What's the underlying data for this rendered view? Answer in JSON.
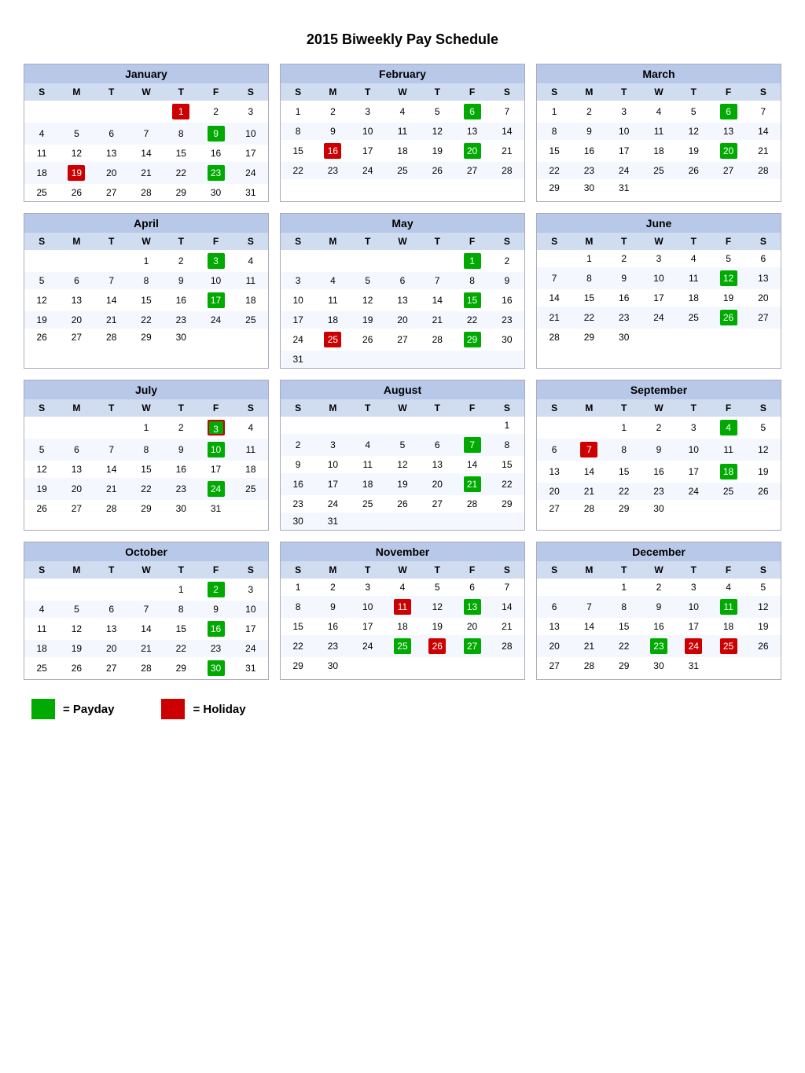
{
  "title": "2015 Biweekly Pay Schedule",
  "months": [
    {
      "name": "January",
      "weeks": [
        [
          "",
          "",
          "",
          "",
          "1H",
          "2",
          "3"
        ],
        [
          "4",
          "5",
          "6",
          "7",
          "8",
          "9P",
          "10"
        ],
        [
          "11",
          "12",
          "13",
          "14",
          "15",
          "16",
          "17"
        ],
        [
          "18",
          "19H",
          "20",
          "21",
          "22",
          "23P",
          "24"
        ],
        [
          "25",
          "26",
          "27",
          "28",
          "29",
          "30",
          "31"
        ]
      ]
    },
    {
      "name": "February",
      "weeks": [
        [
          "1",
          "2",
          "3",
          "4",
          "5",
          "6P",
          "7"
        ],
        [
          "8",
          "9",
          "10",
          "11",
          "12",
          "13",
          "14"
        ],
        [
          "15",
          "16H",
          "17",
          "18",
          "19",
          "20P",
          "21"
        ],
        [
          "22",
          "23",
          "24",
          "25",
          "26",
          "27",
          "28"
        ]
      ]
    },
    {
      "name": "March",
      "weeks": [
        [
          "1",
          "2",
          "3",
          "4",
          "5",
          "6P",
          "7"
        ],
        [
          "8",
          "9",
          "10",
          "11",
          "12",
          "13",
          "14"
        ],
        [
          "15",
          "16",
          "17",
          "18",
          "19",
          "20P",
          "21"
        ],
        [
          "22",
          "23",
          "24",
          "25",
          "26",
          "27",
          "28"
        ],
        [
          "29",
          "30",
          "31",
          "",
          "",
          "",
          ""
        ]
      ]
    },
    {
      "name": "April",
      "weeks": [
        [
          "",
          "",
          "",
          "1",
          "2",
          "3P",
          "4"
        ],
        [
          "5",
          "6",
          "7",
          "8",
          "9",
          "10",
          "11"
        ],
        [
          "12",
          "13",
          "14",
          "15",
          "16",
          "17P",
          "18"
        ],
        [
          "19",
          "20",
          "21",
          "22",
          "23",
          "24",
          "25"
        ],
        [
          "26",
          "27",
          "28",
          "29",
          "30",
          "",
          ""
        ]
      ]
    },
    {
      "name": "May",
      "weeks": [
        [
          "",
          "",
          "",
          "",
          "",
          "1P",
          "2"
        ],
        [
          "3",
          "4",
          "5",
          "6",
          "7",
          "8",
          "9"
        ],
        [
          "10",
          "11",
          "12",
          "13",
          "14",
          "15P",
          "16"
        ],
        [
          "17",
          "18",
          "19",
          "20",
          "21",
          "22",
          "23"
        ],
        [
          "24",
          "25H",
          "26",
          "27",
          "28",
          "29P",
          "30"
        ],
        [
          "31",
          "",
          "",
          "",
          "",
          "",
          ""
        ]
      ]
    },
    {
      "name": "June",
      "weeks": [
        [
          "",
          "1",
          "2",
          "3",
          "4",
          "5",
          "6"
        ],
        [
          "7",
          "8",
          "9",
          "10",
          "11",
          "12P",
          "13"
        ],
        [
          "14",
          "15",
          "16",
          "17",
          "18",
          "19",
          "20"
        ],
        [
          "21",
          "22",
          "23",
          "24",
          "25",
          "26P",
          "27"
        ],
        [
          "28",
          "29",
          "30",
          "",
          "",
          "",
          ""
        ]
      ]
    },
    {
      "name": "July",
      "weeks": [
        [
          "",
          "",
          "",
          "1",
          "2",
          "3PH",
          "4"
        ],
        [
          "5",
          "6",
          "7",
          "8",
          "9",
          "10P",
          "11"
        ],
        [
          "12",
          "13",
          "14",
          "15",
          "16",
          "17",
          "18"
        ],
        [
          "19",
          "20",
          "21",
          "22",
          "23",
          "24P",
          "25"
        ],
        [
          "26",
          "27",
          "28",
          "29",
          "30",
          "31",
          ""
        ]
      ]
    },
    {
      "name": "August",
      "weeks": [
        [
          "",
          "",
          "",
          "",
          "",
          "",
          "1"
        ],
        [
          "2",
          "3",
          "4",
          "5",
          "6",
          "7P",
          "8"
        ],
        [
          "9",
          "10",
          "11",
          "12",
          "13",
          "14",
          "15"
        ],
        [
          "16",
          "17",
          "18",
          "19",
          "20",
          "21P",
          "22"
        ],
        [
          "23",
          "24",
          "25",
          "26",
          "27",
          "28",
          "29"
        ],
        [
          "30",
          "31",
          "",
          "",
          "",
          "",
          ""
        ]
      ]
    },
    {
      "name": "September",
      "weeks": [
        [
          "",
          "",
          "1",
          "2",
          "3",
          "4P",
          "5"
        ],
        [
          "6",
          "7H",
          "8",
          "9",
          "10",
          "11",
          "12"
        ],
        [
          "13",
          "14",
          "15",
          "16",
          "17",
          "18P",
          "19"
        ],
        [
          "20",
          "21",
          "22",
          "23",
          "24",
          "25",
          "26"
        ],
        [
          "27",
          "28",
          "29",
          "30",
          "",
          "",
          ""
        ]
      ]
    },
    {
      "name": "October",
      "weeks": [
        [
          "",
          "",
          "",
          "",
          "1",
          "2P",
          "3"
        ],
        [
          "4",
          "5",
          "6",
          "7",
          "8",
          "9",
          "10"
        ],
        [
          "11",
          "12",
          "13",
          "14",
          "15",
          "16P",
          "17"
        ],
        [
          "18",
          "19",
          "20",
          "21",
          "22",
          "23",
          "24"
        ],
        [
          "25",
          "26",
          "27",
          "28",
          "29",
          "30P",
          "31"
        ]
      ]
    },
    {
      "name": "November",
      "weeks": [
        [
          "1",
          "2",
          "3",
          "4",
          "5",
          "6",
          "7"
        ],
        [
          "8",
          "9",
          "10",
          "11H",
          "12",
          "13P",
          "14"
        ],
        [
          "15",
          "16",
          "17",
          "18",
          "19",
          "20",
          "21"
        ],
        [
          "22",
          "23",
          "24",
          "25P",
          "26H",
          "27P",
          "28"
        ],
        [
          "29",
          "30",
          "",
          "",
          "",
          "",
          ""
        ]
      ]
    },
    {
      "name": "December",
      "weeks": [
        [
          "",
          "",
          "1",
          "2",
          "3",
          "4",
          "5"
        ],
        [
          "6",
          "7",
          "8",
          "9",
          "10",
          "11P",
          "12"
        ],
        [
          "13",
          "14",
          "15",
          "16",
          "17",
          "18",
          "19"
        ],
        [
          "20",
          "21",
          "22",
          "23P",
          "24H",
          "25H",
          "26"
        ],
        [
          "27",
          "28",
          "29",
          "30",
          "31",
          "",
          ""
        ]
      ]
    }
  ],
  "legend": {
    "payday_label": "= Payday",
    "holiday_label": "= Holiday"
  }
}
